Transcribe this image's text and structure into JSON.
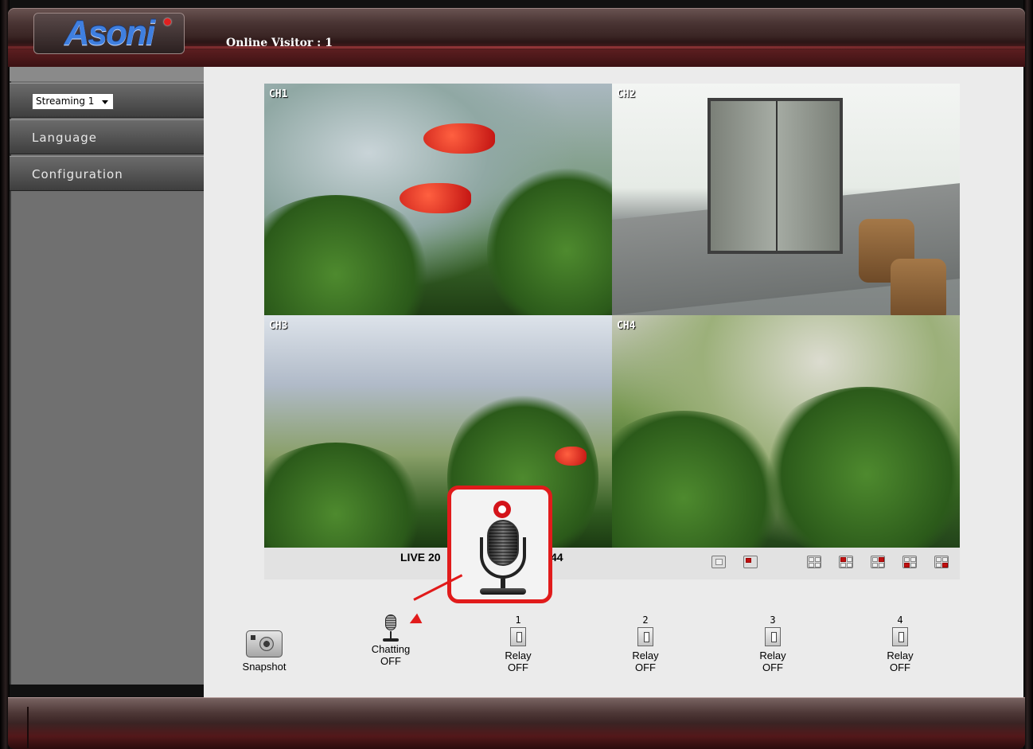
{
  "header": {
    "logo_text": "Asoni",
    "online_visitor": "Online Visitor : 1"
  },
  "sidebar": {
    "stream_select": {
      "value": "Streaming 1"
    },
    "items": [
      {
        "label": "Language"
      },
      {
        "label": "Configuration"
      }
    ]
  },
  "cameras": [
    {
      "tag": "CH1"
    },
    {
      "tag": "CH2"
    },
    {
      "tag": "CH3"
    },
    {
      "tag": "CH4"
    }
  ],
  "status": {
    "live_left": "LIVE 20",
    "live_right": "44"
  },
  "controls": {
    "snapshot": {
      "label": "Snapshot"
    },
    "chatting": {
      "label": "Chatting",
      "state": "OFF"
    },
    "relays": [
      {
        "num": "1",
        "label": "Relay",
        "state": "OFF"
      },
      {
        "num": "2",
        "label": "Relay",
        "state": "OFF"
      },
      {
        "num": "3",
        "label": "Relay",
        "state": "OFF"
      },
      {
        "num": "4",
        "label": "Relay",
        "state": "OFF"
      }
    ]
  },
  "icons": [
    "camera-icon",
    "microphone-icon",
    "relay-switch-icon",
    "record-dot-icon",
    "layout-single-icon",
    "layout-grid-icon",
    "dropdown-arrow-icon"
  ],
  "colors": {
    "accent_red": "#e11b1b",
    "header_maroon": "#5a1d1f",
    "sidebar_gray": "#707070",
    "content_bg": "#ebebeb",
    "logo_blue": "#3f7fe0"
  }
}
